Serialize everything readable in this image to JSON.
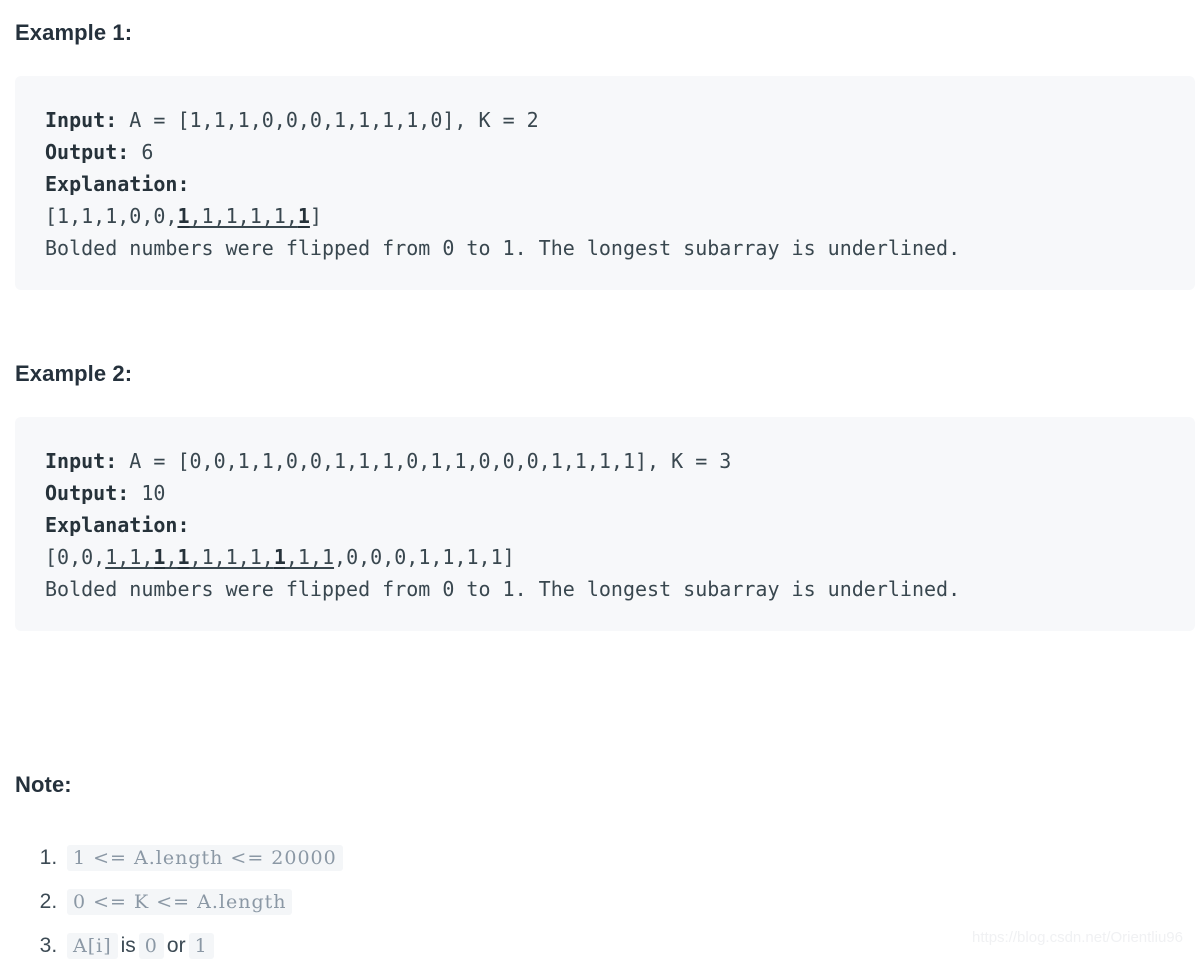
{
  "headings": {
    "example1": "Example 1:",
    "example2": "Example 2:",
    "note": "Note:"
  },
  "example1": {
    "input_label": "Input:",
    "input_value": " A = [1,1,1,0,0,0,1,1,1,1,0], K = 2",
    "output_label": "Output:",
    "output_value": " 6",
    "explanation_label": "Explanation:",
    "array_prefix": "[1,1,1,0,0,",
    "array_bold_1": "1",
    "array_mid": ",1,1,1,1,",
    "array_bold_2": "1",
    "array_suffix": "]",
    "note_line": "Bolded numbers were flipped from 0 to 1.  The longest subarray is underlined."
  },
  "example2": {
    "input_label": "Input:",
    "input_value": " A = [0,0,1,1,0,0,1,1,1,0,1,1,0,0,0,1,1,1,1], K = 3",
    "output_label": "Output:",
    "output_value": " 10",
    "explanation_label": "Explanation:",
    "array_prefix": "[0,0,",
    "array_u1": "1,1,",
    "array_bold_1": "1",
    "array_sep_1": ",",
    "array_bold_2": "1",
    "array_u2": ",1,1,1,",
    "array_bold_3": "1",
    "array_u3": ",1,1",
    "array_suffix": ",0,0,0,1,1,1,1]",
    "note_line": "Bolded numbers were flipped from 0 to 1.  The longest subarray is underlined."
  },
  "notes": [
    {
      "code": "1 <= A.length <= 20000"
    },
    {
      "code": "0 <= K <= A.length"
    },
    {
      "code_a": "A[i]",
      "word_1": "is",
      "code_b": "0",
      "word_2": "or",
      "code_c": "1"
    }
  ],
  "watermark": "https://blog.csdn.net/Orientliu96"
}
